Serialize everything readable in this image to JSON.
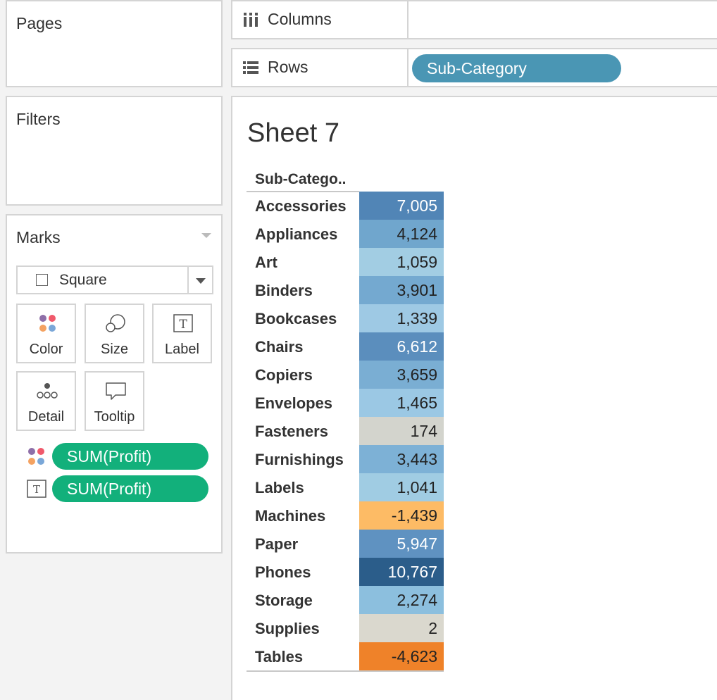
{
  "cards": {
    "pages_title": "Pages",
    "filters_title": "Filters",
    "marks_title": "Marks"
  },
  "marks": {
    "type_label": "Square",
    "buttons": {
      "color": "Color",
      "size": "Size",
      "label": "Label",
      "detail": "Detail",
      "tooltip": "Tooltip"
    },
    "pills": [
      "SUM(Profit)",
      "SUM(Profit)"
    ]
  },
  "shelves": {
    "columns_label": "Columns",
    "rows_label": "Rows",
    "rows_pill": "Sub-Category"
  },
  "colors": {
    "rows_pill": "#4a96b4",
    "measure_pill": "#12b07b"
  },
  "sheet": {
    "title": "Sheet 7",
    "header": "Sub-Catego.."
  },
  "chart_data": {
    "type": "table",
    "header": "Sub-Catego..",
    "categories": [
      "Accessories",
      "Appliances",
      "Art",
      "Binders",
      "Bookcases",
      "Chairs",
      "Copiers",
      "Envelopes",
      "Fasteners",
      "Furnishings",
      "Labels",
      "Machines",
      "Paper",
      "Phones",
      "Storage",
      "Supplies",
      "Tables"
    ],
    "values": [
      7005,
      4124,
      1059,
      3901,
      1339,
      6612,
      3659,
      1465,
      174,
      3443,
      1041,
      -1439,
      5947,
      10767,
      2274,
      2,
      -4623
    ],
    "labels": [
      "7,005",
      "4,124",
      "1,059",
      "3,901",
      "1,339",
      "6,612",
      "3,659",
      "1,465",
      "174",
      "3,443",
      "1,041",
      "-1,439",
      "5,947",
      "10,767",
      "2,274",
      "2",
      "-4,623"
    ],
    "cell_colors": [
      "#5185b6",
      "#70a6cd",
      "#a2cde3",
      "#74a9d0",
      "#9ec9e4",
      "#5b8ebd",
      "#7aaed3",
      "#9bc8e4",
      "#d3d4cd",
      "#7db1d6",
      "#a0cce3",
      "#fdbb65",
      "#5f92c1",
      "#2b5d8a",
      "#8cbfde",
      "#dad8ce",
      "#ef8229"
    ],
    "cell_text_colors": [
      "#ffffff",
      "#222222",
      "#222222",
      "#222222",
      "#222222",
      "#ffffff",
      "#222222",
      "#222222",
      "#222222",
      "#222222",
      "#222222",
      "#222222",
      "#ffffff",
      "#ffffff",
      "#222222",
      "#222222",
      "#222222"
    ]
  }
}
